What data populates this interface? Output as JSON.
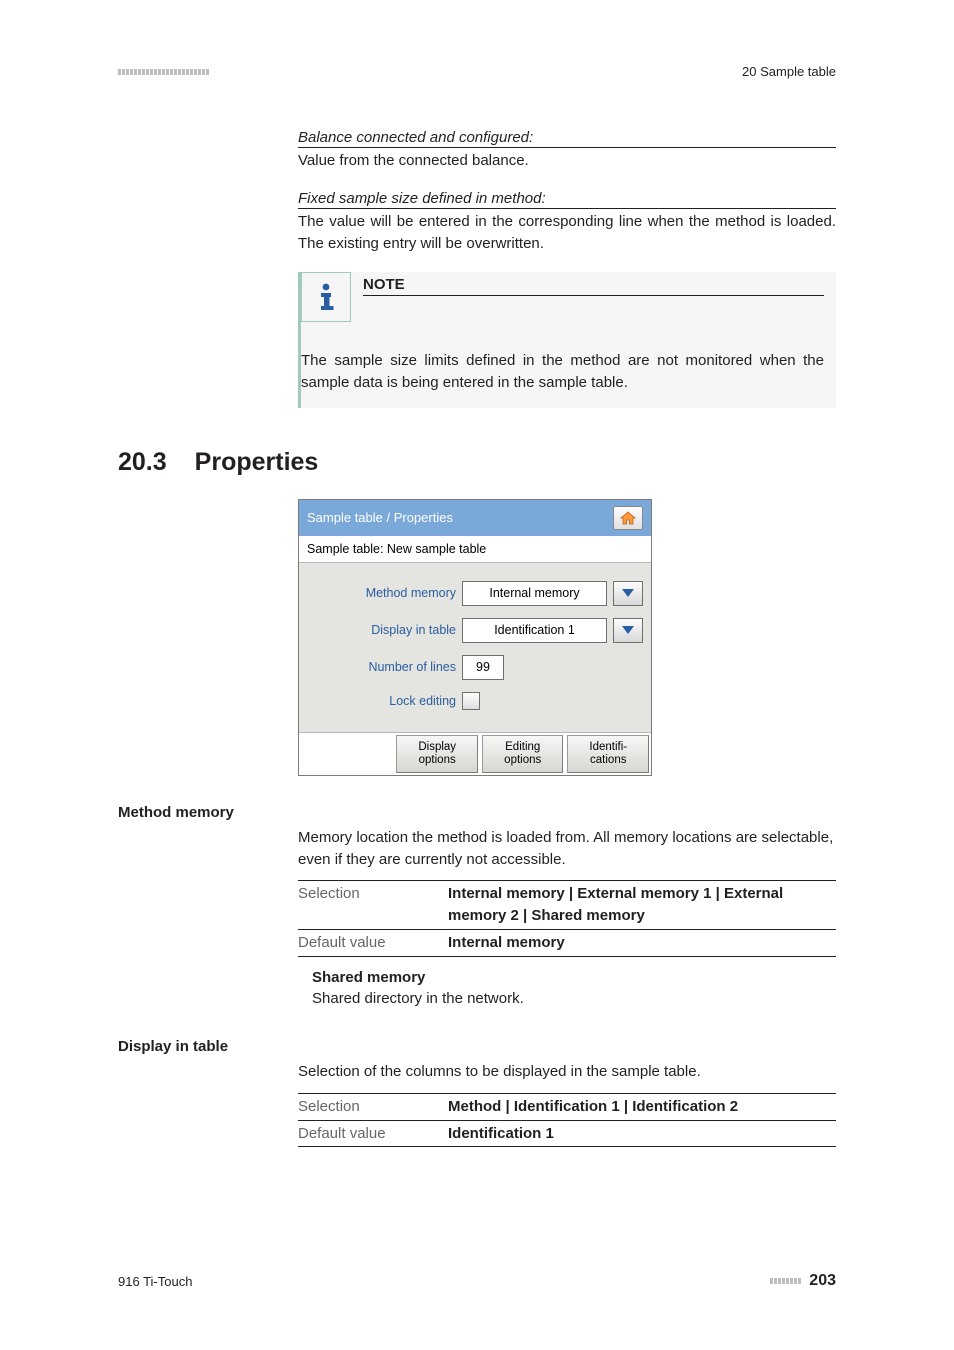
{
  "header": {
    "right_text": "20 Sample table"
  },
  "defs": [
    {
      "title": "Balance connected and configured:",
      "body": "Value from the connected balance."
    },
    {
      "title": "Fixed sample size defined in method:",
      "body": "The value will be entered in the corresponding line when the method is loaded. The existing entry will be overwritten."
    }
  ],
  "note": {
    "label": "NOTE",
    "text": "The sample size limits defined in the method are not monitored when the sample data is being entered in the sample table."
  },
  "section": {
    "number": "20.3",
    "title": "Properties"
  },
  "panel": {
    "breadcrumb": "Sample table / Properties",
    "subtitle": "Sample table: New sample table",
    "rows": {
      "method_memory": {
        "label": "Method memory",
        "value": "Internal memory"
      },
      "display_in_table": {
        "label": "Display in table",
        "value": "Identification 1"
      },
      "number_of_lines": {
        "label": "Number of lines",
        "value": "99"
      },
      "lock_editing": {
        "label": "Lock editing"
      }
    },
    "buttons": {
      "display_options": "Display\noptions",
      "editing_options": "Editing\noptions",
      "identifications": "Identifi-\ncations"
    }
  },
  "terms": {
    "method_memory": {
      "heading": "Method memory",
      "body": "Memory location the method is loaded from. All memory locations are selectable, even if they are currently not accessible.",
      "selection_label": "Selection",
      "selection_value": "Internal memory | External memory 1 | External memory 2 | Shared memory",
      "default_label": "Default value",
      "default_value": "Internal memory",
      "sub_title": "Shared memory",
      "sub_body": "Shared directory in the network."
    },
    "display_in_table": {
      "heading": "Display in table",
      "body": "Selection of the columns to be displayed in the sample table.",
      "selection_label": "Selection",
      "selection_value": "Method | Identification 1 | Identification 2",
      "default_label": "Default value",
      "default_value": "Identification 1"
    }
  },
  "footer": {
    "left": "916 Ti-Touch",
    "page": "203"
  }
}
